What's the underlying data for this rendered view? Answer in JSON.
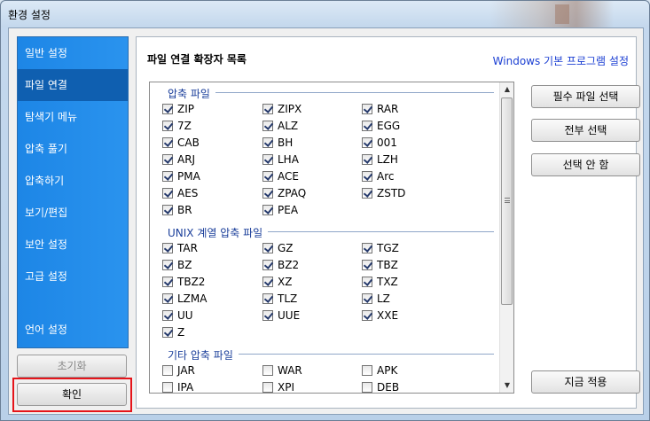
{
  "window": {
    "title": "환경 설정"
  },
  "sidebar": {
    "items": [
      {
        "label": "일반 설정",
        "active": false
      },
      {
        "label": "파일 연결",
        "active": true
      },
      {
        "label": "탐색기 메뉴",
        "active": false
      },
      {
        "label": "압축 풀기",
        "active": false
      },
      {
        "label": "압축하기",
        "active": false
      },
      {
        "label": "보기/편집",
        "active": false
      },
      {
        "label": "보안 설정",
        "active": false
      },
      {
        "label": "고급 설정",
        "active": false
      },
      {
        "label": "언어 설정",
        "active": false
      }
    ],
    "reset_label": "초기화",
    "ok_label": "확인"
  },
  "main": {
    "title": "파일 연결 확장자 목록",
    "link": "Windows 기본 프로그램 설정",
    "groups": [
      {
        "header": "압축 파일",
        "items": [
          {
            "label": "ZIP",
            "checked": true
          },
          {
            "label": "ZIPX",
            "checked": true
          },
          {
            "label": "RAR",
            "checked": true
          },
          {
            "label": "7Z",
            "checked": true
          },
          {
            "label": "ALZ",
            "checked": true
          },
          {
            "label": "EGG",
            "checked": true
          },
          {
            "label": "CAB",
            "checked": true
          },
          {
            "label": "BH",
            "checked": true
          },
          {
            "label": "001",
            "checked": true
          },
          {
            "label": "ARJ",
            "checked": true
          },
          {
            "label": "LHA",
            "checked": true
          },
          {
            "label": "LZH",
            "checked": true
          },
          {
            "label": "PMA",
            "checked": true
          },
          {
            "label": "ACE",
            "checked": true
          },
          {
            "label": "Arc",
            "checked": true
          },
          {
            "label": "AES",
            "checked": true
          },
          {
            "label": "ZPAQ",
            "checked": true
          },
          {
            "label": "ZSTD",
            "checked": true
          },
          {
            "label": "BR",
            "checked": true
          },
          {
            "label": "PEA",
            "checked": true
          }
        ]
      },
      {
        "header": "UNIX 계열 압축 파일",
        "items": [
          {
            "label": "TAR",
            "checked": true
          },
          {
            "label": "GZ",
            "checked": true
          },
          {
            "label": "TGZ",
            "checked": true
          },
          {
            "label": "BZ",
            "checked": true
          },
          {
            "label": "BZ2",
            "checked": true
          },
          {
            "label": "TBZ",
            "checked": true
          },
          {
            "label": "TBZ2",
            "checked": true
          },
          {
            "label": "XZ",
            "checked": true
          },
          {
            "label": "TXZ",
            "checked": true
          },
          {
            "label": "LZMA",
            "checked": true
          },
          {
            "label": "TLZ",
            "checked": true
          },
          {
            "label": "LZ",
            "checked": true
          },
          {
            "label": "UU",
            "checked": true
          },
          {
            "label": "UUE",
            "checked": true
          },
          {
            "label": "XXE",
            "checked": true
          },
          {
            "label": "Z",
            "checked": true
          }
        ]
      },
      {
        "header": "기타 압축 파일",
        "items": [
          {
            "label": "JAR",
            "checked": false
          },
          {
            "label": "WAR",
            "checked": false
          },
          {
            "label": "APK",
            "checked": false
          },
          {
            "label": "IPA",
            "checked": false
          },
          {
            "label": "XPI",
            "checked": false
          },
          {
            "label": "DEB",
            "checked": false
          }
        ]
      }
    ],
    "buttons": {
      "select_required": "필수 파일 선택",
      "select_all": "전부 선택",
      "select_none": "선택 안 함",
      "apply_now": "지금 적용"
    }
  },
  "colors": {
    "sidebar_bg": "#1d86e6",
    "sidebar_active": "#0f5fb0",
    "link": "#1b3fd3",
    "group_header": "#1a3e9a",
    "focus_frame": "#e5141a"
  }
}
